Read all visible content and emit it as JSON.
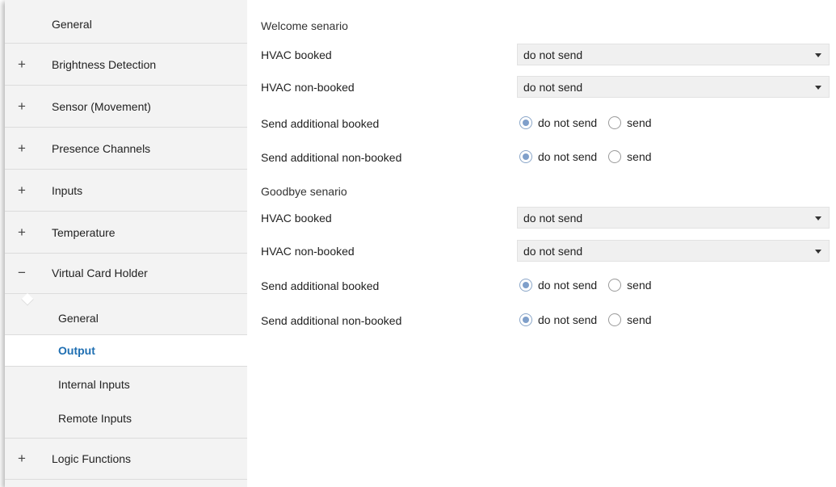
{
  "sidebar": {
    "items": [
      {
        "label": "General",
        "sign": ""
      },
      {
        "label": "Brightness Detection",
        "sign": "+"
      },
      {
        "label": "Sensor (Movement)",
        "sign": "+"
      },
      {
        "label": "Presence Channels",
        "sign": "+"
      },
      {
        "label": "Inputs",
        "sign": "+"
      },
      {
        "label": "Temperature",
        "sign": "+"
      },
      {
        "label": "Virtual Card Holder",
        "sign": "−"
      }
    ],
    "sub_items": [
      {
        "label": "General"
      },
      {
        "label": "Output"
      },
      {
        "label": "Internal Inputs"
      },
      {
        "label": "Remote Inputs"
      }
    ],
    "bottom_item": {
      "label": "Logic Functions",
      "sign": "+"
    }
  },
  "main": {
    "welcome": {
      "title": "Welcome senario",
      "hvac_booked": {
        "label": "HVAC booked",
        "value": "do not send"
      },
      "hvac_non_booked": {
        "label": "HVAC non-booked",
        "value": "do not send"
      },
      "additional_booked": {
        "label": "Send additional booked",
        "options": [
          "do not send",
          "send"
        ],
        "selected": "do not send"
      },
      "additional_non_booked": {
        "label": "Send additional non-booked",
        "options": [
          "do not send",
          "send"
        ],
        "selected": "do not send"
      }
    },
    "goodbye": {
      "title": "Goodbye senario",
      "hvac_booked": {
        "label": "HVAC booked",
        "value": "do not send"
      },
      "hvac_non_booked": {
        "label": "HVAC non-booked",
        "value": "do not send"
      },
      "additional_booked": {
        "label": "Send additional booked",
        "options": [
          "do not send",
          "send"
        ],
        "selected": "do not send"
      },
      "additional_non_booked": {
        "label": "Send additional non-booked",
        "options": [
          "do not send",
          "send"
        ],
        "selected": "do not send"
      }
    }
  },
  "colors": {
    "accent": "#1f6fb2",
    "sidebar_bg": "#f3f3f3",
    "radio_selected": "#7f9fca"
  }
}
